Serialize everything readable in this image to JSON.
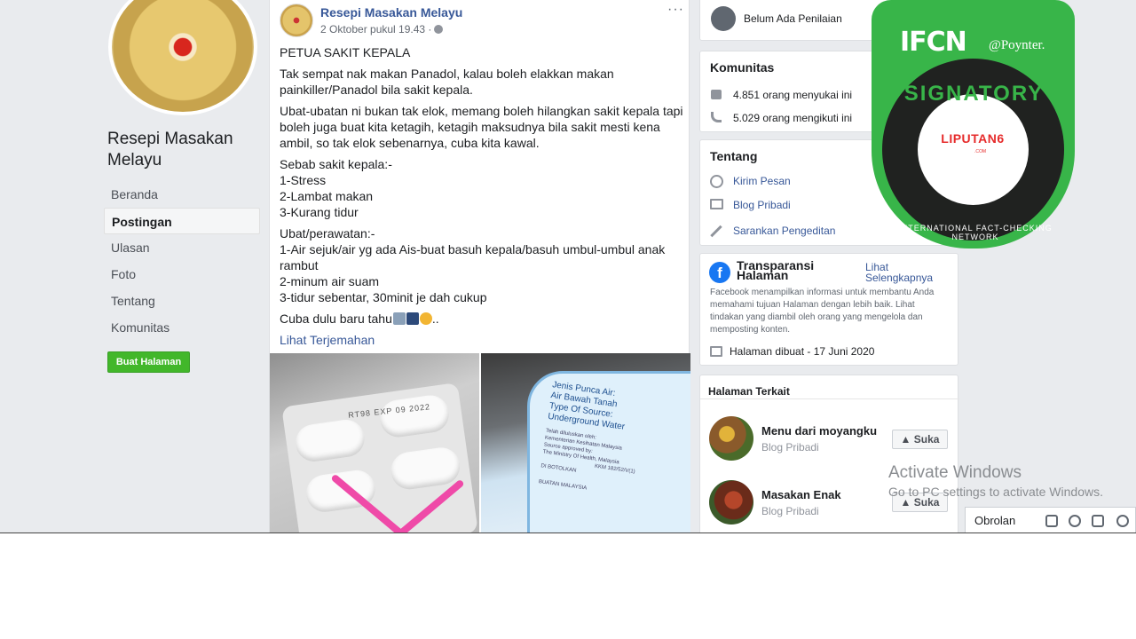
{
  "page": {
    "name": "Resepi Masakan Melayu"
  },
  "nav": {
    "items": [
      "Beranda",
      "Postingan",
      "Ulasan",
      "Foto",
      "Tentang",
      "Komunitas"
    ],
    "active": "Postingan",
    "create_button": "Buat Halaman"
  },
  "post": {
    "author": "Resepi Masakan Melayu",
    "date": "2 Oktober pukul 19.43 ·",
    "menu": "···",
    "title": "PETUA SAKIT KEPALA",
    "p1": "Tak sempat nak makan Panadol, kalau boleh elakkan makan painkiller/Panadol bila sakit kepala.",
    "p2": "Ubat-ubatan ni bukan tak elok, memang boleh hilangkan sakit kepala tapi boleh juga buat kita ketagih, ketagih maksudnya bila sakit mesti kena ambil, so tak elok sebenarnya, cuba kita kawal.",
    "p3": "Sebab sakit kepala:-\n1-Stress\n2-Lambat makan\n3-Kurang tidur",
    "p4": "Ubat/perawatan:-\n1-Air sejuk/air yg ada Ais-buat basuh kepala/basuh umbul-umbul anak rambut\n2-minum air suam\n3-tidur sebentar, 30minit je dah cukup",
    "p5": "Cuba dulu baru tahu",
    "p5_tail": "..",
    "see_translation": "Lihat Terjemahan",
    "blister_code": "RT98  EXP 09 2022",
    "bottle_label": [
      "Jenis Punca Air:",
      "Air Bawah Tanah",
      "Type Of Source:",
      "Underground Water"
    ],
    "bottle_small": [
      "Telah diluluskan oleh:",
      "Kementerian Kesihatan Malaysia",
      "Source approved by:",
      "The Ministry Of Health, Malaysia",
      "KKM 182/52/V(1)",
      "DI BOTOLKAN",
      "BUATAN MALAYSIA"
    ]
  },
  "rating": {
    "text": "Belum Ada Penilaian"
  },
  "community": {
    "title": "Komunitas",
    "likes": "4.851 orang menyukai ini",
    "follows": "5.029 orang mengikuti ini"
  },
  "about": {
    "title": "Tentang",
    "send_message": "Kirim Pesan",
    "category": "Blog Pribadi",
    "suggest_edit": "Sarankan Pengeditan"
  },
  "transparency": {
    "title": "Transparansi Halaman",
    "see_all": "Lihat Selengkapnya",
    "description": "Facebook menampilkan informasi untuk membantu Anda memahami tujuan Halaman dengan lebih baik. Lihat tindakan yang diambil oleh orang yang mengelola dan memposting konten.",
    "created": "Halaman dibuat - 17 Juni 2020"
  },
  "related": {
    "title": "Halaman Terkait",
    "pages": [
      {
        "name": "Menu dari moyangku",
        "category": "Blog Pribadi",
        "button": "Suka"
      },
      {
        "name": "Masakan Enak",
        "category": "Blog Pribadi",
        "button": "Suka"
      }
    ]
  },
  "badge": {
    "ifcn": "IFCN",
    "poynter": "@Poynter.",
    "signatory": "SIGNATORY",
    "network": "INTERNATIONAL FACT-CHECKING NETWORK",
    "partner": "LIPUTAN6",
    "partner_domain": ".COM",
    "colors": {
      "green": "#38b549",
      "dark": "#202220",
      "partner_red": "#e62b2b"
    }
  },
  "windows": {
    "activate_title": "Activate Windows",
    "activate_sub": "Go to PC settings to activate Windows."
  },
  "chat": {
    "label": "Obrolan",
    "icons": [
      "edit-icon",
      "group-icon",
      "video-icon",
      "gear-icon"
    ]
  },
  "colors": {
    "background": "#e9ebee",
    "link": "#385898",
    "create_button": "#42b72a",
    "facebook": "#1877f2"
  }
}
